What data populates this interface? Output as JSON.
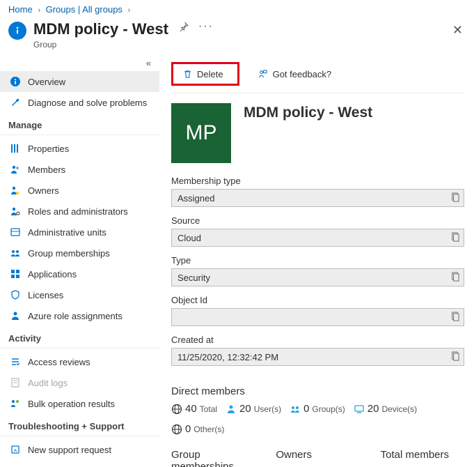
{
  "breadcrumb": {
    "home": "Home",
    "groups": "Groups | All groups"
  },
  "header": {
    "title": "MDM policy - West",
    "subtitle": "Group"
  },
  "sidebar": {
    "overview": "Overview",
    "diagnose": "Diagnose and solve problems",
    "manage_header": "Manage",
    "properties": "Properties",
    "members": "Members",
    "owners": "Owners",
    "roles": "Roles and administrators",
    "admin_units": "Administrative units",
    "group_memberships": "Group memberships",
    "applications": "Applications",
    "licenses": "Licenses",
    "azure_role": "Azure role assignments",
    "activity_header": "Activity",
    "access_reviews": "Access reviews",
    "audit_logs": "Audit logs",
    "bulk_ops": "Bulk operation results",
    "trouble_header": "Troubleshooting + Support",
    "new_support": "New support request"
  },
  "toolbar": {
    "delete": "Delete",
    "feedback": "Got feedback?"
  },
  "entity": {
    "initials": "MP",
    "name": "MDM policy - West"
  },
  "fields": {
    "membership_type": {
      "label": "Membership type",
      "value": "Assigned"
    },
    "source": {
      "label": "Source",
      "value": "Cloud"
    },
    "type": {
      "label": "Type",
      "value": "Security"
    },
    "object_id": {
      "label": "Object Id",
      "value": ""
    },
    "created_at": {
      "label": "Created at",
      "value": "11/25/2020, 12:32:42 PM"
    }
  },
  "direct_members": {
    "title": "Direct members",
    "total": {
      "num": "40",
      "label": "Total"
    },
    "users": {
      "num": "20",
      "label": "User(s)"
    },
    "groups": {
      "num": "0",
      "label": "Group(s)"
    },
    "devices": {
      "num": "20",
      "label": "Device(s)"
    },
    "others": {
      "num": "0",
      "label": "Other(s)"
    }
  },
  "lower": {
    "group_memberships": "Group memberships",
    "owners": "Owners",
    "total_members": "Total members"
  }
}
